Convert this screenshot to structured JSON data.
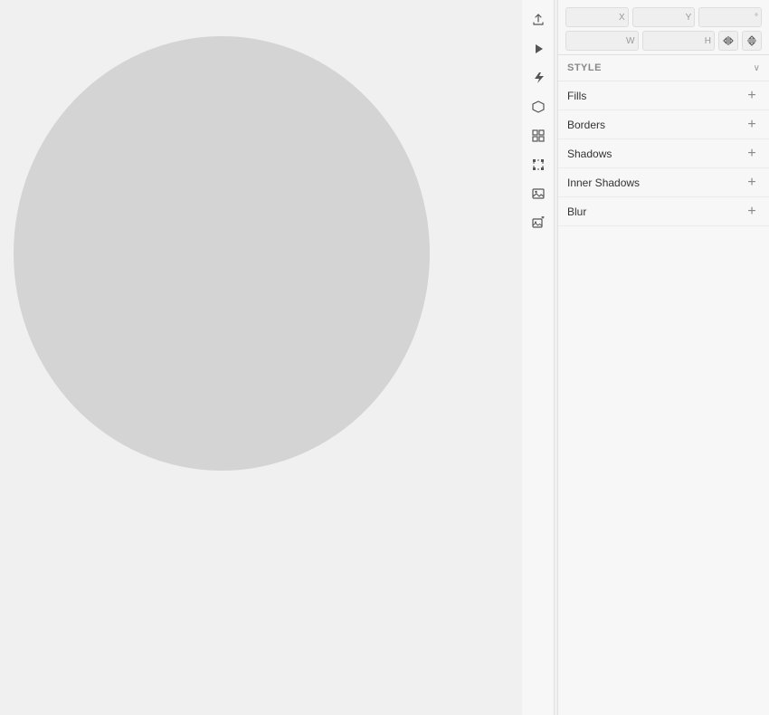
{
  "canvas": {
    "background": "#f0f0f0",
    "circle_color": "#d4d4d4"
  },
  "toolbar": {
    "icons": [
      {
        "name": "export-icon",
        "symbol": "↑",
        "label": "Export"
      },
      {
        "name": "play-icon",
        "symbol": "▶",
        "label": "Play"
      },
      {
        "name": "lightning-icon",
        "symbol": "⚡",
        "label": "Lightning"
      },
      {
        "name": "hexagon-icon",
        "symbol": "⬡",
        "label": "Component"
      },
      {
        "name": "grid-icon",
        "symbol": "▦",
        "label": "Grid"
      },
      {
        "name": "selection-icon",
        "symbol": "⊡",
        "label": "Selection"
      },
      {
        "name": "image-icon",
        "symbol": "🖼",
        "label": "Image"
      },
      {
        "name": "add-image-icon",
        "symbol": "⊞",
        "label": "Add Image"
      }
    ]
  },
  "right_panel": {
    "coords": {
      "x_label": "X",
      "y_label": "Y",
      "r_label": "°",
      "x_value": "",
      "y_value": "",
      "r_value": ""
    },
    "dims": {
      "w_label": "W",
      "h_label": "H",
      "w_value": "",
      "h_value": ""
    },
    "style_section": {
      "label": "STYLE",
      "chevron": "∨"
    },
    "style_rows": [
      {
        "id": "fills",
        "label": "Fills"
      },
      {
        "id": "borders",
        "label": "Borders"
      },
      {
        "id": "shadows",
        "label": "Shadows"
      },
      {
        "id": "inner-shadows",
        "label": "Inner Shadows"
      },
      {
        "id": "blur",
        "label": "Blur"
      }
    ],
    "add_button_label": "+"
  }
}
